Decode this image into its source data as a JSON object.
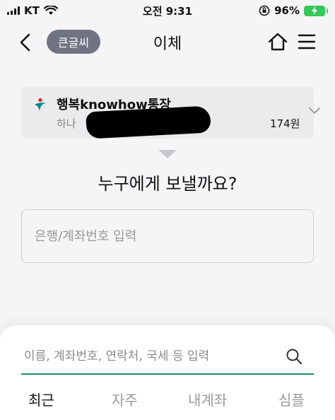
{
  "status_bar": {
    "carrier": "KT",
    "time": "오전 9:31",
    "battery_text": "96%"
  },
  "nav": {
    "font_size_button": "큰글씨",
    "title": "이체"
  },
  "account": {
    "name": "행복knowhow통장",
    "number_prefix": "하나",
    "balance": "174원"
  },
  "question": "누구에게 보낼까요?",
  "bank_input": {
    "placeholder": "은행/계좌번호 입력"
  },
  "sheet": {
    "search_placeholder": "이름, 계좌번호, 연락처, 국세 등 입력",
    "tabs": [
      {
        "label": "최근"
      },
      {
        "label": "자주"
      },
      {
        "label": "내계좌"
      },
      {
        "label": "심플"
      }
    ]
  },
  "colors": {
    "accent": "#1a8a6c",
    "font_button_bg": "#6f7382",
    "battery": "#34c759"
  }
}
